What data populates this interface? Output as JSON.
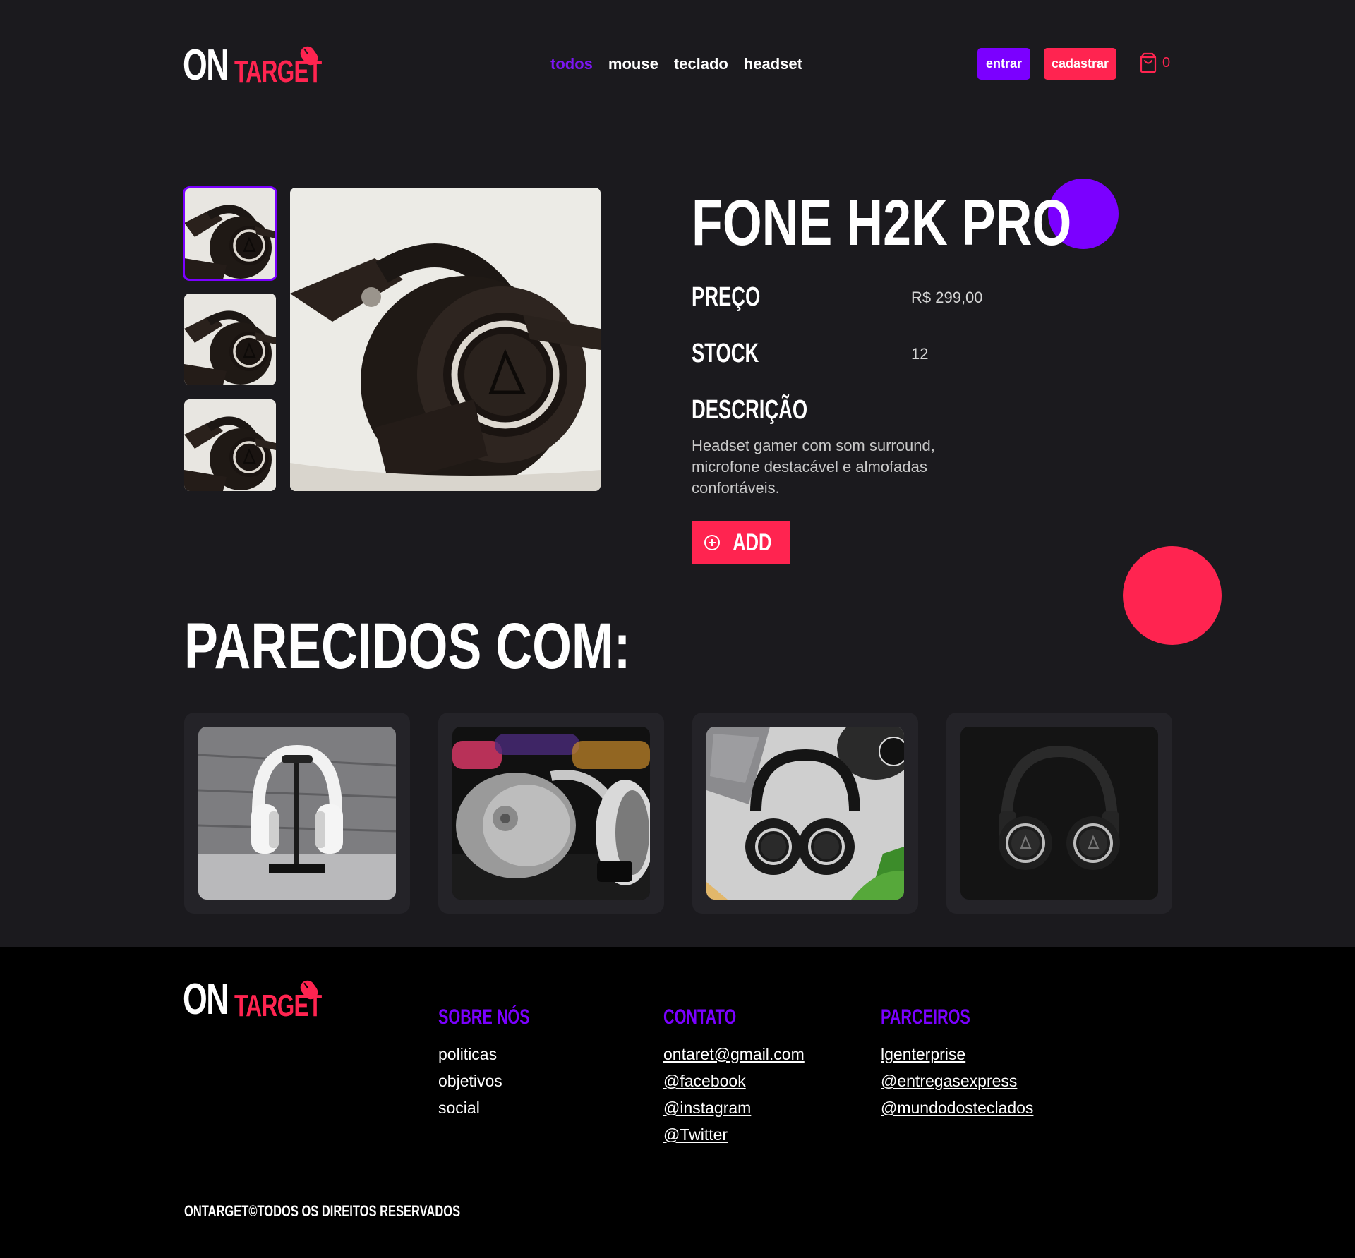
{
  "brand": {
    "on": "ON",
    "target": "TARGET"
  },
  "nav": {
    "items": [
      "todos",
      "mouse",
      "teclado",
      "headset"
    ],
    "active": "todos"
  },
  "auth": {
    "login": "entrar",
    "signup": "cadastrar"
  },
  "cart": {
    "count": "0"
  },
  "product": {
    "title": "FONE H2K PRO",
    "price_label": "PREÇO",
    "price": "R$ 299,00",
    "stock_label": "STOCK",
    "stock": "12",
    "description_label": "DESCRIÇÃO",
    "description": "Headset gamer com som surround, microfone destacável e almofadas confortáveis.",
    "add_label": "ADD"
  },
  "similar": {
    "title": "PARECIDOS COM:"
  },
  "footer": {
    "about": {
      "title": "SOBRE NÓS",
      "items": [
        "politicas",
        "objetivos",
        "social"
      ]
    },
    "contact": {
      "title": "CONTATO",
      "items": [
        "ontaret@gmail.com",
        "@facebook",
        "@instagram",
        "@Twitter"
      ]
    },
    "partners": {
      "title": "PARCEIROS",
      "items": [
        "lgenterprise",
        "@entregasexpress",
        "@mundodosteclados"
      ]
    },
    "copyright": "ONTARGET©TODOS OS DIREITOS RESERVADOS"
  },
  "colors": {
    "purple": "#7b00ff",
    "red": "#ff2450",
    "bg": "#1b1a1e",
    "footer": "#000000"
  }
}
